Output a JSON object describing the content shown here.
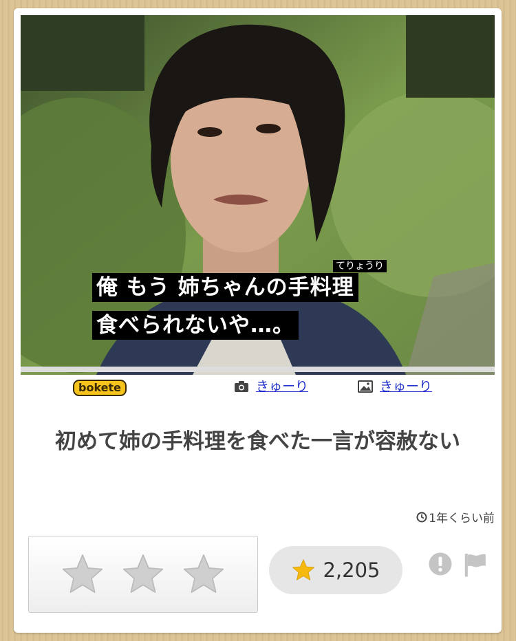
{
  "post": {
    "photo": {
      "caption_furigana": "てりょうり",
      "caption_line1": "俺 もう 姉ちゃんの手料理",
      "caption_line2": "食べられないや…。"
    },
    "logo_text": "bokete",
    "photo_credit": {
      "icon": "camera-icon",
      "user": "きゅーり"
    },
    "boke_credit": {
      "icon": "image-icon",
      "user": "きゅーり"
    },
    "title": "初めて姉の手料理を食べた一言が容赦ない",
    "timestamp": "1年くらい前",
    "rating": {
      "stars": 3,
      "icon": "star-outline-icon"
    },
    "score": {
      "value": "2,205",
      "icon": "star-icon",
      "color": "#f5b90f"
    },
    "actions": {
      "report_icon": "exclamation-icon",
      "flag_icon": "flag-icon"
    }
  }
}
